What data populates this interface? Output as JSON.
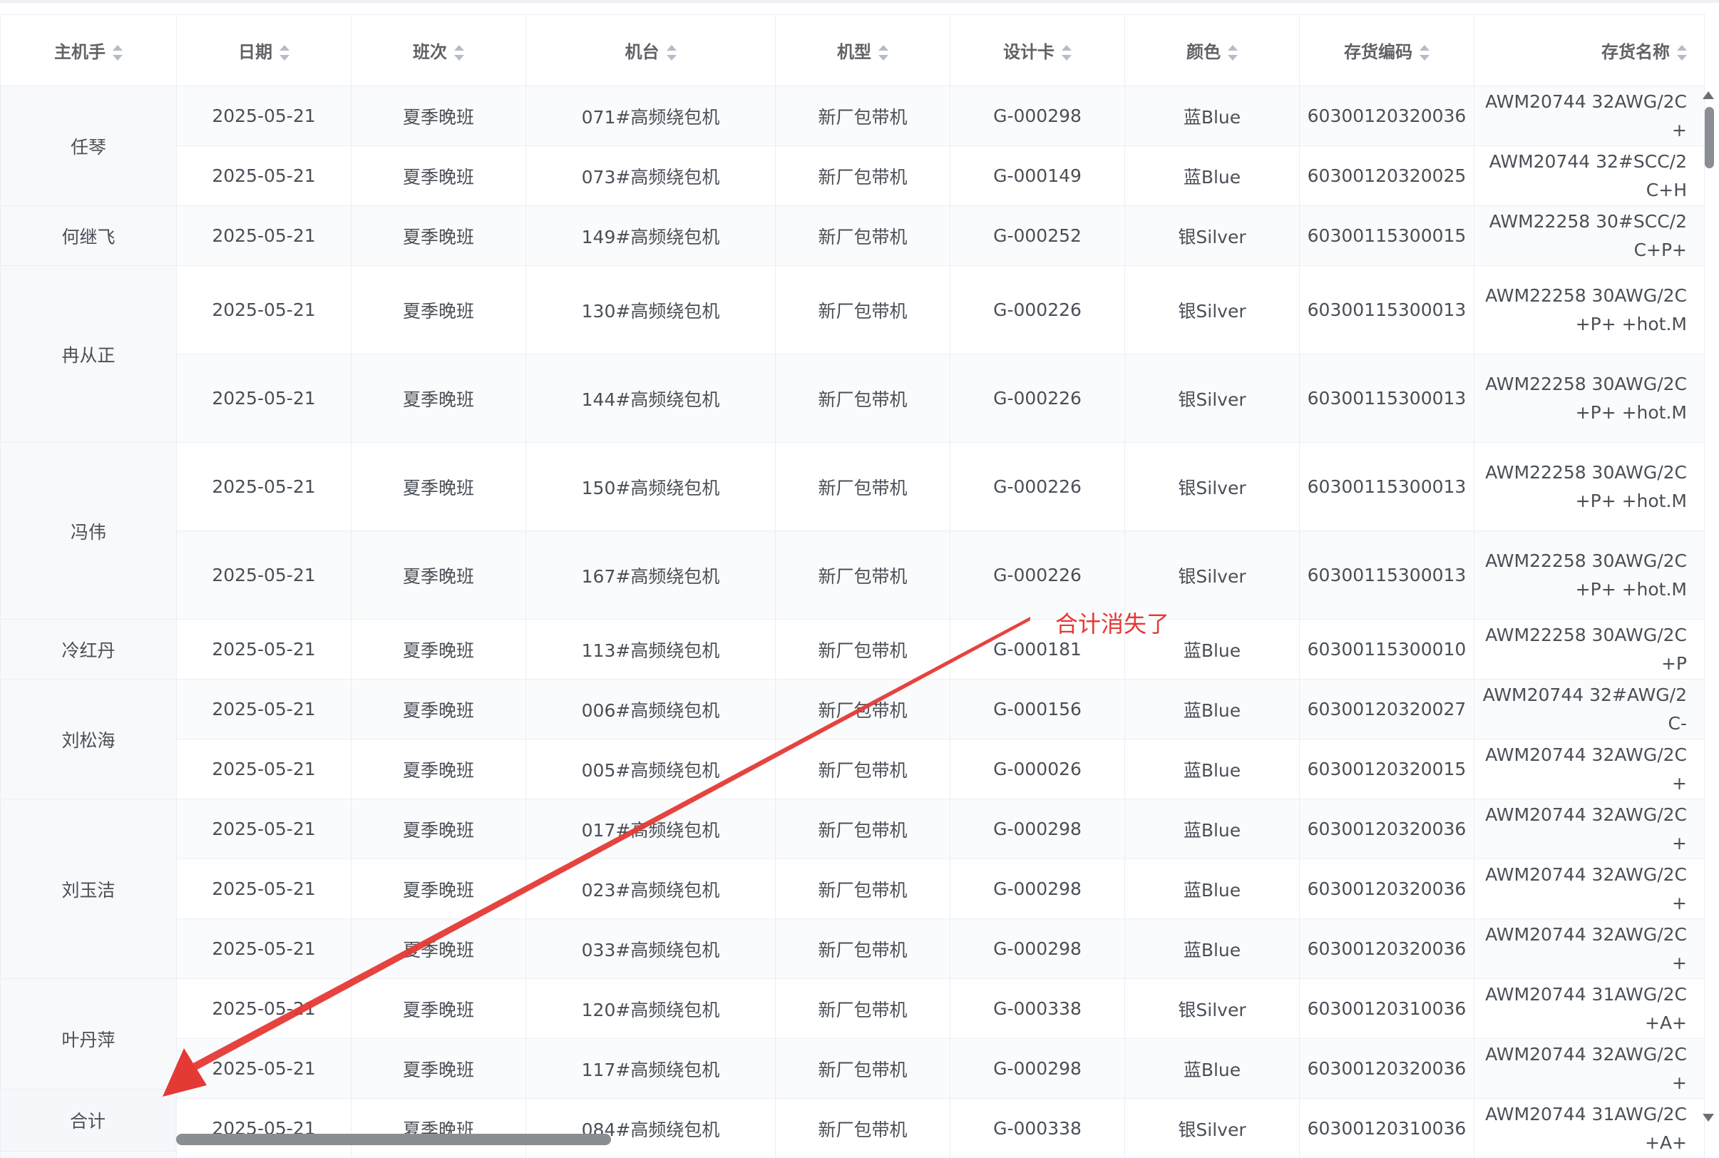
{
  "headers": [
    "主机手",
    "日期",
    "班次",
    "机台",
    "机型",
    "设计卡",
    "颜色",
    "存货编码",
    "存货名称"
  ],
  "groups": [
    {
      "operator": "任琴",
      "rows": [
        {
          "date": "2025-05-21",
          "shift": "夏季晚班",
          "machine": "071#高频绕包机",
          "type": "新厂包带机",
          "card": "G-000298",
          "color": "蓝Blue",
          "code": "60300120320036",
          "name": "AWM20744 32AWG/2C+",
          "tall": false
        },
        {
          "date": "2025-05-21",
          "shift": "夏季晚班",
          "machine": "073#高频绕包机",
          "type": "新厂包带机",
          "card": "G-000149",
          "color": "蓝Blue",
          "code": "60300120320025",
          "name": "AWM20744 32#SCC/2C+H",
          "tall": false
        }
      ]
    },
    {
      "operator": "何继飞",
      "rows": [
        {
          "date": "2025-05-21",
          "shift": "夏季晚班",
          "machine": "149#高频绕包机",
          "type": "新厂包带机",
          "card": "G-000252",
          "color": "银Silver",
          "code": "60300115300015",
          "name": "AWM22258 30#SCC/2C+P+",
          "tall": false
        }
      ]
    },
    {
      "operator": "冉从正",
      "rows": [
        {
          "date": "2025-05-21",
          "shift": "夏季晚班",
          "machine": "130#高频绕包机",
          "type": "新厂包带机",
          "card": "G-000226",
          "color": "银Silver",
          "code": "60300115300013",
          "name": "AWM22258 30AWG/2C+P+ +hot.M",
          "tall": true
        },
        {
          "date": "2025-05-21",
          "shift": "夏季晚班",
          "machine": "144#高频绕包机",
          "type": "新厂包带机",
          "card": "G-000226",
          "color": "银Silver",
          "code": "60300115300013",
          "name": "AWM22258 30AWG/2C+P+ +hot.M",
          "tall": true
        }
      ]
    },
    {
      "operator": "冯伟",
      "rows": [
        {
          "date": "2025-05-21",
          "shift": "夏季晚班",
          "machine": "150#高频绕包机",
          "type": "新厂包带机",
          "card": "G-000226",
          "color": "银Silver",
          "code": "60300115300013",
          "name": "AWM22258 30AWG/2C+P+ +hot.M",
          "tall": true
        },
        {
          "date": "2025-05-21",
          "shift": "夏季晚班",
          "machine": "167#高频绕包机",
          "type": "新厂包带机",
          "card": "G-000226",
          "color": "银Silver",
          "code": "60300115300013",
          "name": "AWM22258 30AWG/2C+P+ +hot.M",
          "tall": true
        }
      ]
    },
    {
      "operator": "冷红丹",
      "rows": [
        {
          "date": "2025-05-21",
          "shift": "夏季晚班",
          "machine": "113#高频绕包机",
          "type": "新厂包带机",
          "card": "G-000181",
          "color": "蓝Blue",
          "code": "60300115300010",
          "name": "AWM22258 30AWG/2C+P",
          "tall": false
        }
      ]
    },
    {
      "operator": "刘松海",
      "rows": [
        {
          "date": "2025-05-21",
          "shift": "夏季晚班",
          "machine": "006#高频绕包机",
          "type": "新厂包带机",
          "card": "G-000156",
          "color": "蓝Blue",
          "code": "60300120320027",
          "name": "AWM20744 32#AWG/2C-",
          "tall": false
        },
        {
          "date": "2025-05-21",
          "shift": "夏季晚班",
          "machine": "005#高频绕包机",
          "type": "新厂包带机",
          "card": "G-000026",
          "color": "蓝Blue",
          "code": "60300120320015",
          "name": "AWM20744 32AWG/2C+",
          "tall": false
        }
      ]
    },
    {
      "operator": "刘玉洁",
      "rows": [
        {
          "date": "2025-05-21",
          "shift": "夏季晚班",
          "machine": "017#高频绕包机",
          "type": "新厂包带机",
          "card": "G-000298",
          "color": "蓝Blue",
          "code": "60300120320036",
          "name": "AWM20744 32AWG/2C+",
          "tall": false
        },
        {
          "date": "2025-05-21",
          "shift": "夏季晚班",
          "machine": "023#高频绕包机",
          "type": "新厂包带机",
          "card": "G-000298",
          "color": "蓝Blue",
          "code": "60300120320036",
          "name": "AWM20744 32AWG/2C+",
          "tall": false
        },
        {
          "date": "2025-05-21",
          "shift": "夏季晚班",
          "machine": "033#高频绕包机",
          "type": "新厂包带机",
          "card": "G-000298",
          "color": "蓝Blue",
          "code": "60300120320036",
          "name": "AWM20744 32AWG/2C+",
          "tall": false
        }
      ]
    },
    {
      "operator": "叶丹萍",
      "rows": [
        {
          "date": "2025-05-21",
          "shift": "夏季晚班",
          "machine": "120#高频绕包机",
          "type": "新厂包带机",
          "card": "G-000338",
          "color": "银Silver",
          "code": "60300120310036",
          "name": "AWM20744 31AWG/2C+A+",
          "tall": false
        },
        {
          "date": "2025-05-21",
          "shift": "夏季晚班",
          "machine": "117#高频绕包机",
          "type": "新厂包带机",
          "card": "G-000298",
          "color": "蓝Blue",
          "code": "60300120320036",
          "name": "AWM20744 32AWG/2C+",
          "tall": false
        }
      ]
    },
    {
      "operator": "",
      "rows": [
        {
          "date": "2025-05-21",
          "shift": "夏季晚班",
          "machine": "084#高频绕包机",
          "type": "新厂包带机",
          "card": "G-000338",
          "color": "银Silver",
          "code": "60300120310036",
          "name": "AWM20744 31AWG/2C+A+",
          "tall": false
        }
      ]
    }
  ],
  "summary_label": "合计",
  "annotation": "合计消失了",
  "colors": {
    "annotation": "#e53935",
    "border": "#ebeef5",
    "header_text": "#606266"
  }
}
